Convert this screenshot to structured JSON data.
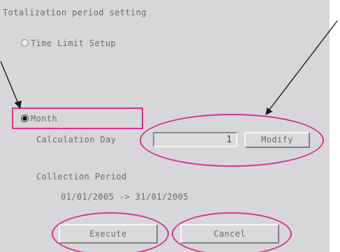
{
  "dialog": {
    "title": "Totalization period setting"
  },
  "time_limit_option": {
    "label": "Time Limit Setup",
    "selected": false
  },
  "month_option": {
    "label": "Month",
    "selected": true
  },
  "calculation_day": {
    "label": "Calculation Day",
    "value": "1",
    "modify_label": "Modify"
  },
  "collection_period": {
    "label": "Collection Period",
    "range": "01/01/2005 -> 31/01/2005"
  },
  "buttons": {
    "execute_label": "Execute",
    "cancel_label": "Cancel"
  },
  "annotations": {
    "highlight_color": "#d6338f",
    "arrow_color": "#1a1a1a"
  }
}
